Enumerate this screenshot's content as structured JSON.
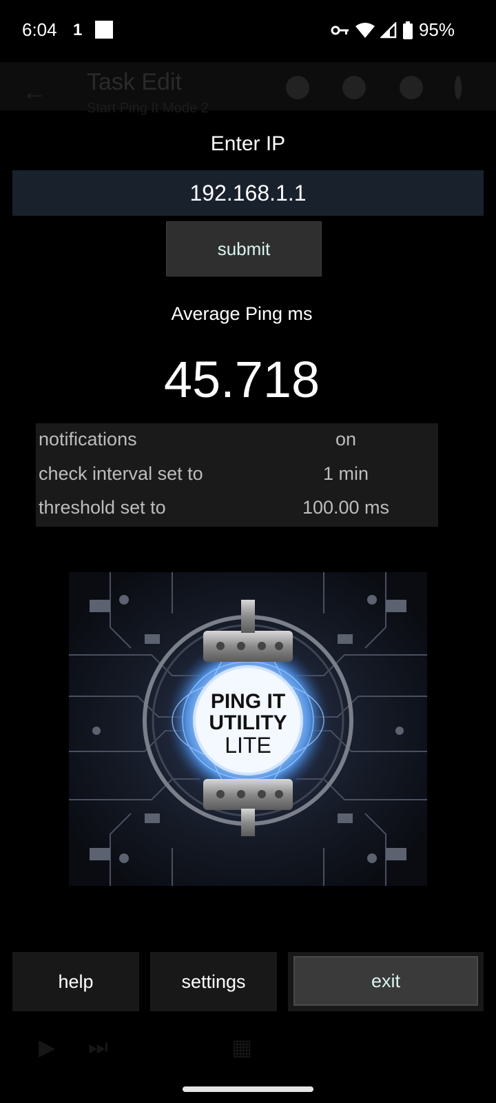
{
  "status_bar": {
    "time": "6:04",
    "notification_glyph": "1",
    "battery_percent": "95%",
    "icons": [
      "vpn-key-icon",
      "wifi-icon",
      "signal-icon",
      "battery-icon"
    ]
  },
  "background_app": {
    "title": "Task Edit",
    "subtitle": "Start Ping It Mode 2"
  },
  "dialog": {
    "enter_ip_label": "Enter IP",
    "ip_value": "192.168.1.1",
    "submit_label": "submit",
    "avg_label": "Average Ping ms",
    "avg_value": "45.718",
    "settings": [
      {
        "label": "notifications",
        "value": "on"
      },
      {
        "label": "check interval set to",
        "value": "1 min"
      },
      {
        "label": "threshold set to",
        "value": "100.00 ms"
      }
    ],
    "logo": {
      "line1": "PING IT",
      "line2": "UTILITY",
      "line3": "LITE"
    },
    "buttons": {
      "help": "help",
      "settings": "settings",
      "exit": "exit"
    }
  },
  "colors": {
    "background": "#000000",
    "input_bg": "#19212d",
    "button_bg": "#2f2f2f",
    "panel_bg": "#1a1a1a",
    "accent_text": "#d9f4f0"
  }
}
